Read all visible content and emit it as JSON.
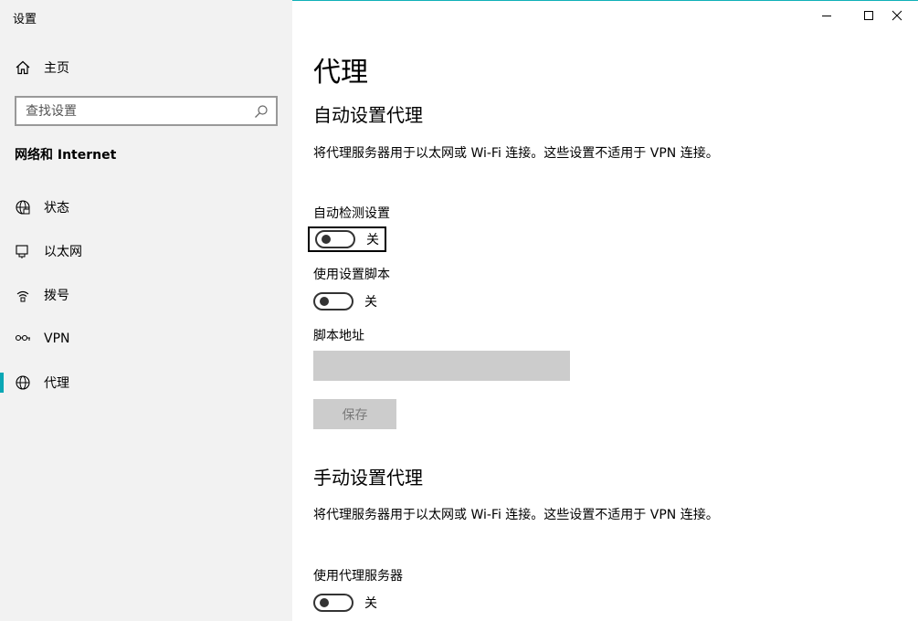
{
  "app": {
    "title": "设置"
  },
  "sidebar": {
    "home_label": "主页",
    "search_placeholder": "查找设置",
    "section_title": "网络和 Internet",
    "items": [
      {
        "label": "状态",
        "icon": "globe-status-icon"
      },
      {
        "label": "以太网",
        "icon": "ethernet-icon"
      },
      {
        "label": "拨号",
        "icon": "dialup-icon"
      },
      {
        "label": "VPN",
        "icon": "vpn-icon"
      },
      {
        "label": "代理",
        "icon": "globe-icon",
        "active": true
      }
    ]
  },
  "window_controls": {
    "icons": [
      "minimize-icon",
      "maximize-icon",
      "close-icon"
    ]
  },
  "main": {
    "title": "代理",
    "auto": {
      "heading": "自动设置代理",
      "description": "将代理服务器用于以太网或 Wi-Fi 连接。这些设置不适用于 VPN 连接。",
      "detect_label": "自动检测设置",
      "detect_state": "关",
      "script_label": "使用设置脚本",
      "script_state": "关",
      "address_label": "脚本地址",
      "address_value": "",
      "save_label": "保存"
    },
    "manual": {
      "heading": "手动设置代理",
      "description": "将代理服务器用于以太网或 Wi-Fi 连接。这些设置不适用于 VPN 连接。",
      "proxy_label": "使用代理服务器",
      "proxy_state": "关"
    }
  },
  "colors": {
    "accent": "#0aa7b5",
    "sidebar_bg": "#f2f2f2",
    "disabled": "#cccccc"
  }
}
